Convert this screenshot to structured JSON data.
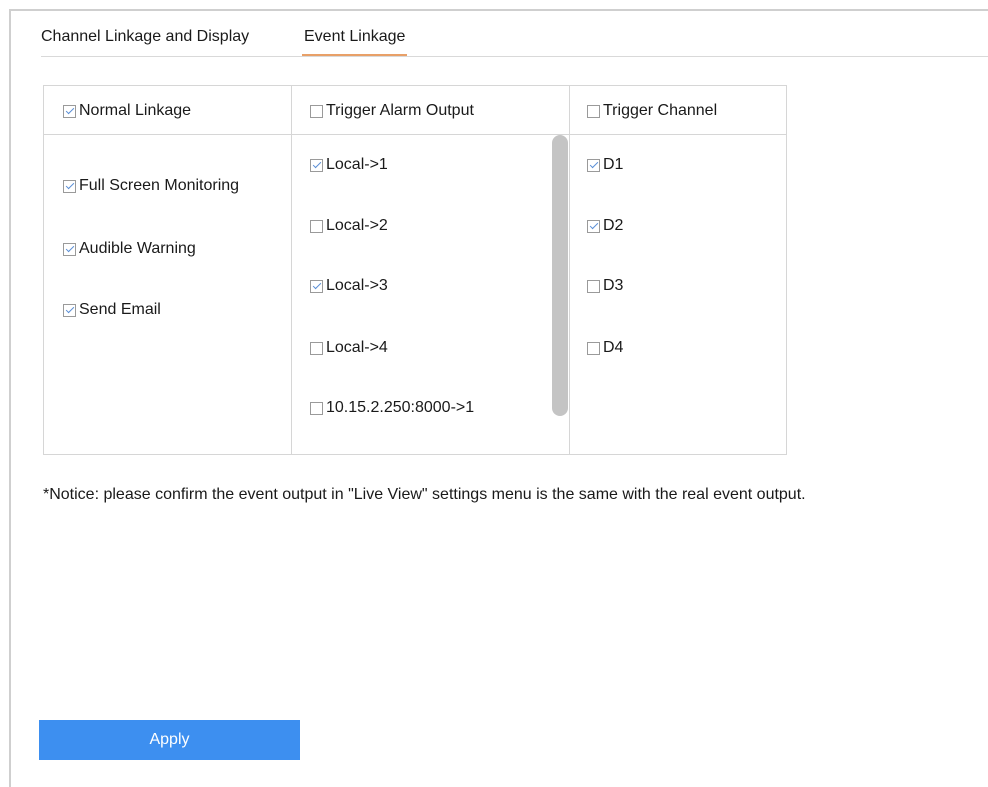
{
  "tabs": [
    {
      "label": "Channel Linkage and Display",
      "active": false
    },
    {
      "label": "Event Linkage",
      "active": true
    }
  ],
  "columns": {
    "normal": {
      "header": "Normal Linkage",
      "header_checked": true,
      "items": [
        {
          "label": "Full Screen Monitoring",
          "checked": true
        },
        {
          "label": "Audible Warning",
          "checked": true
        },
        {
          "label": "Send Email",
          "checked": true
        }
      ]
    },
    "alarm": {
      "header": "Trigger Alarm Output",
      "header_checked": false,
      "items": [
        {
          "label": "Local->1",
          "checked": true
        },
        {
          "label": "Local->2",
          "checked": false
        },
        {
          "label": "Local->3",
          "checked": true
        },
        {
          "label": "Local->4",
          "checked": false
        },
        {
          "label": "10.15.2.250:8000->1",
          "checked": false
        }
      ]
    },
    "channel": {
      "header": "Trigger Channel",
      "header_checked": false,
      "items": [
        {
          "label": "D1",
          "checked": true
        },
        {
          "label": "D2",
          "checked": true
        },
        {
          "label": "D3",
          "checked": false
        },
        {
          "label": "D4",
          "checked": false
        }
      ]
    }
  },
  "notice": "*Notice: please confirm the event output in \"Live View\" settings menu is the same with the real event output.",
  "apply_label": "Apply",
  "colors": {
    "accent": "#3d8ff0",
    "tab_underline": "#e8a068",
    "check": "#5b8fd6"
  }
}
